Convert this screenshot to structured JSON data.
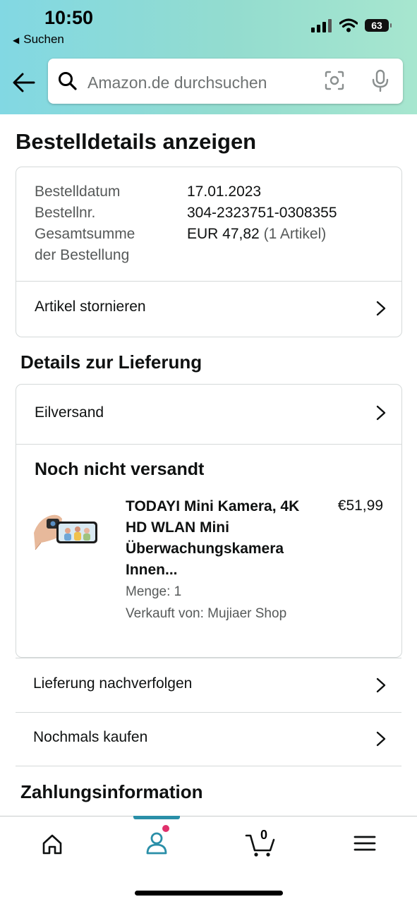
{
  "status_bar": {
    "time": "10:50",
    "back_app": "Suchen",
    "battery": "63"
  },
  "search": {
    "placeholder": "Amazon.de durchsuchen"
  },
  "page": {
    "title": "Bestelldetails anzeigen"
  },
  "order_summary": {
    "date_label": "Bestelldatum",
    "date_value": "17.01.2023",
    "number_label": "Bestellnr.",
    "number_value": "304-2323751-0308355",
    "total_label_line1": "Gesamtsumme",
    "total_label_line2": "der Bestellung",
    "total_value": "EUR 47,82",
    "total_items": "(1 Artikel)",
    "cancel_label": "Artikel stornieren"
  },
  "delivery": {
    "section_title": "Details zur Lieferung",
    "shipping_method": "Eilversand",
    "status": "Noch nicht versandt",
    "item": {
      "name": "TODAYI Mini Kamera, 4K HD WLAN Mini Überwachungskamera Innen...",
      "price": "€51,99",
      "quantity": "Menge: 1",
      "seller": "Verkauft von: Mujiaer Shop"
    },
    "track_label": "Lieferung nachverfolgen",
    "buy_again_label": "Nochmals kaufen"
  },
  "payment": {
    "section_title": "Zahlungsinformation"
  },
  "tabbar": {
    "cart_count": "0"
  },
  "colors": {
    "accent": "#2a8fa8",
    "notification": "#e0306b",
    "header_start": "#82d8e3",
    "header_end": "#a7e6cf"
  }
}
